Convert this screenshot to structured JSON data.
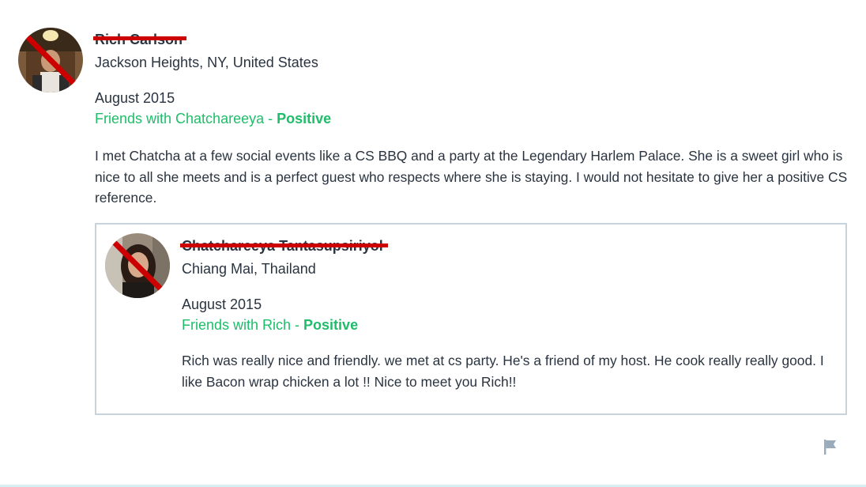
{
  "reference": {
    "author": {
      "name": "Rich Carlson",
      "location": "Jackson Heights, NY, United States",
      "avatar_icon": "user-photo-avatar"
    },
    "date": "August 2015",
    "relationship": {
      "prefix": "Friends with Chatchareeya - ",
      "rating": "Positive"
    },
    "text": "I met Chatcha at a few social events like a CS BBQ and a party at the Legendary Harlem Palace. She is a sweet girl who is nice to all she meets and is a perfect guest who respects where she is staying. I would not hesitate to give her a positive CS reference."
  },
  "response": {
    "author": {
      "name": "Chatchareeya Tantasupsiriyol",
      "location": "Chiang Mai, Thailand",
      "avatar_icon": "user-photo-avatar"
    },
    "date": "August 2015",
    "relationship": {
      "prefix": "Friends with Rich - ",
      "rating": "Positive"
    },
    "text": "Rich was really nice and friendly. we met at cs party. He's a friend of my host. He cook really really good. I like Bacon wrap chicken a lot !! Nice to meet you Rich!!"
  },
  "actions": {
    "report_icon": "flag-icon"
  },
  "colors": {
    "positive": "#1fbd6a",
    "text": "#2a3440",
    "redaction": "#cc0000",
    "border": "#c9d3db",
    "flag": "#9aabbb"
  }
}
